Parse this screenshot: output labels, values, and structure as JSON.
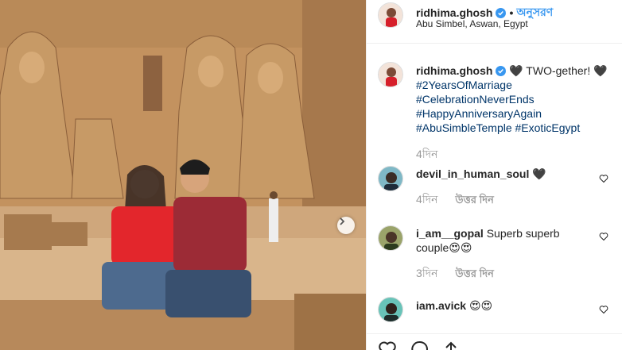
{
  "header": {
    "username": "ridhima.ghosh",
    "separator": "•",
    "follow_label": "অনুসরণ",
    "location": "Abu Simbel, Aswan, Egypt"
  },
  "caption": {
    "username": "ridhima.ghosh",
    "text": "🖤 TWO-gether! 🖤",
    "hashtags": [
      "#2YearsOfMarriage",
      "#CelebrationNeverEnds",
      "#HappyAnniversaryAgain"
    ],
    "last_line_tag_1": "#AbuSimbleTemple",
    "last_line_tag_2": "#ExoticEgypt",
    "time": "4দিন"
  },
  "comments": [
    {
      "username": "devil_in_human_soul",
      "text": "🖤",
      "time": "4দিন",
      "reply_label": "উত্তর দিন"
    },
    {
      "username": "i_am__gopal",
      "text": "Superb superb couple😍😍",
      "time": "3দিন",
      "reply_label": "উত্তর দিন"
    },
    {
      "username": "iam.avick",
      "text": "😍😍"
    }
  ],
  "colors": {
    "link": "#3897f0",
    "hashtag": "#003569",
    "muted": "#999999",
    "verified": "#3897f0"
  },
  "icons": [
    "verified-icon",
    "heart-icon",
    "comment-icon",
    "share-icon",
    "next-arrow-icon"
  ]
}
